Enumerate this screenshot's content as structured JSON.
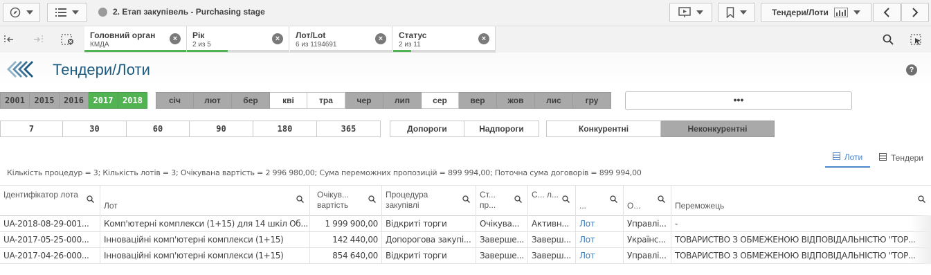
{
  "toolbar": {
    "app_title": "2. Етап закупівель - Purchasing stage",
    "sheet_selector": "Тендери/Лоти"
  },
  "selections": [
    {
      "field": "Головний орган",
      "value": "КМДА",
      "fill": 1.0
    },
    {
      "field": "Рік",
      "value": "2 из 5",
      "fill": 0.4
    },
    {
      "field": "Лот/Lot",
      "value": "6 из 1194691",
      "fill": 0.0
    },
    {
      "field": "Статус",
      "value": "2 из 11",
      "fill": 0.18
    }
  ],
  "sheet": {
    "title": "Тендери/Лоти",
    "help": "?"
  },
  "years": [
    {
      "label": "2001",
      "state": "grey"
    },
    {
      "label": "2015",
      "state": "grey"
    },
    {
      "label": "2016",
      "state": "grey"
    },
    {
      "label": "2017",
      "state": "green"
    },
    {
      "label": "2018",
      "state": "green"
    }
  ],
  "months": [
    {
      "label": "січ",
      "state": "grey"
    },
    {
      "label": "лют",
      "state": "grey"
    },
    {
      "label": "бер",
      "state": "grey"
    },
    {
      "label": "кві",
      "state": "white"
    },
    {
      "label": "тра",
      "state": "white"
    },
    {
      "label": "чер",
      "state": "grey"
    },
    {
      "label": "лип",
      "state": "grey"
    },
    {
      "label": "сер",
      "state": "white"
    },
    {
      "label": "вер",
      "state": "grey"
    },
    {
      "label": "жов",
      "state": "grey"
    },
    {
      "label": "лис",
      "state": "grey"
    },
    {
      "label": "гру",
      "state": "grey"
    }
  ],
  "more_label": "•••",
  "days": [
    "7",
    "30",
    "60",
    "90",
    "180",
    "365"
  ],
  "thresholds": [
    "Допороги",
    "Надпороги"
  ],
  "competition": [
    {
      "label": "Конкурентні",
      "state": "white"
    },
    {
      "label": "Неконкурентні",
      "state": "grey"
    }
  ],
  "view_toggle": {
    "lots": "Лоти",
    "tenders": "Тендери"
  },
  "kpi_text": "Кількість процедур = 3; Кількість лотів = 3; Очікувана вартість = 2 996 980,00; Сума переможних пропозицій = 899 994,00; Поточна сума договорів = 899 994,00",
  "table": {
    "columns": [
      "Ідентифікатор лота",
      "Лот",
      "Очікув... вартість",
      "Процедура закупівлі",
      "Ст... пр...",
      "С... л...",
      "...",
      "О...",
      "Переможець"
    ],
    "rows": [
      [
        "UA-2018-08-29-001...",
        "Комп'ютерні комплекси (1+15) для 14 шкіл Об...",
        "1 999 900,00",
        "Відкриті торги",
        "Очікува...",
        "Активн...",
        "Лот",
        "Управлі...",
        "-"
      ],
      [
        "UA-2017-05-25-000...",
        "Інноваційні комп'ютерні комплекси (1+15)",
        "142 440,00",
        "Допорогова закупі...",
        "Заверше...",
        "Заверш...",
        "Лот",
        "Українс...",
        "ТОВАРИСТВО З ОБМЕЖЕНОЮ ВІДПОВІДАЛЬНІСТЮ \"ТОР..."
      ],
      [
        "UA-2017-04-26-000...",
        "Інноваційні комп'ютерні комплекси (1+15)",
        "854 640,00",
        "Відкриті торги",
        "Заверше...",
        "Заверш...",
        "Лот",
        "Управлі...",
        "ТОВАРИСТВО З ОБМЕЖЕНОЮ ВІДПОВІДАЛЬНІСТЮ \"ТОР..."
      ]
    ]
  },
  "colors": {
    "selected_green": "#52b352",
    "excluded_grey": "#a9a9a9",
    "title_blue": "#1b5b80",
    "link_blue": "#3a7fc1"
  }
}
